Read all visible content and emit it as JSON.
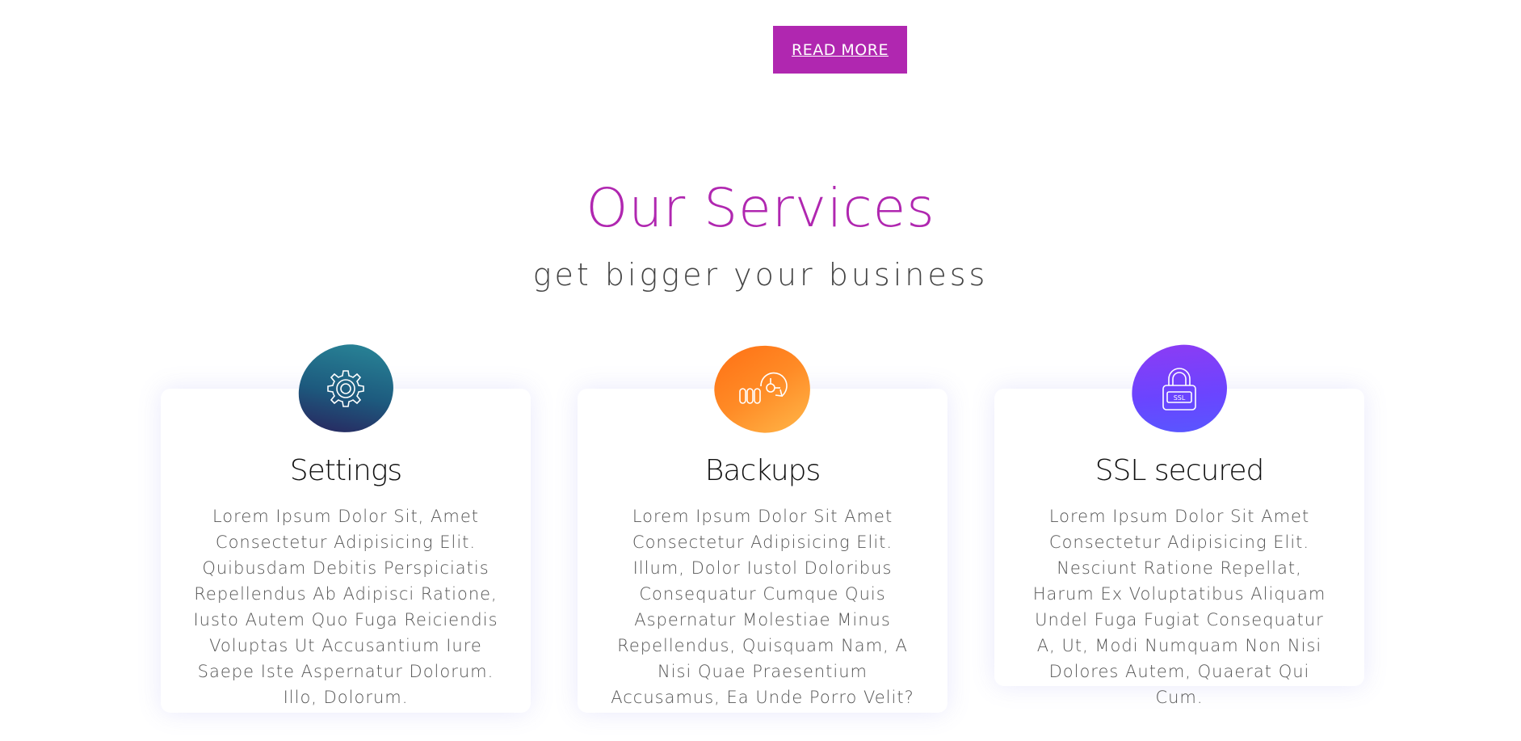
{
  "top_button": {
    "label": "READ MORE"
  },
  "services": {
    "title": "Our Services",
    "subtitle": "get bigger your business",
    "cards": [
      {
        "icon": "gear-icon",
        "title": "Settings",
        "text": "Lorem Ipsum Dolor Sit, Amet Consectetur Adipisicing Elit. Quibusdam Debitis Perspiciatis Repellendus Ab Adipisci Ratione, Iusto Autem Quo Fuga Reiciendis Voluptas Ut Accusantium Iure Saepe Iste Aspernatur Dolorum. Illo, Dolorum."
      },
      {
        "icon": "backup-icon",
        "title": "Backups",
        "text": "Lorem Ipsum Dolor Sit Amet Consectetur Adipisicing Elit. Illum, Dolor Iustol Doloribus Consequatur Cumque Quis Aspernatur Molestiae Minus Repellendus, Quisquam Nam, A Nisi Quae Praesentium Accusamus, Ea Unde Porro Velit?"
      },
      {
        "icon": "ssl-lock-icon",
        "title": "SSL secured",
        "text": "Lorem Ipsum Dolor Sit Amet Consectetur Adipisicing Elit. Nesciunt Ratione Repellat, Harum Ex Voluptatibus Aliquam Undel Fuga Fugiat Consequatur A, Ut, Modi Numquam Non Nisi Dolores Autem, Quaerat Qui Cum."
      }
    ]
  },
  "colors": {
    "accent": "#b027b0",
    "settings_blob": "#1d5a7e",
    "backups_blob": "#ff8b26",
    "ssl_blob": "#6a45ff"
  }
}
